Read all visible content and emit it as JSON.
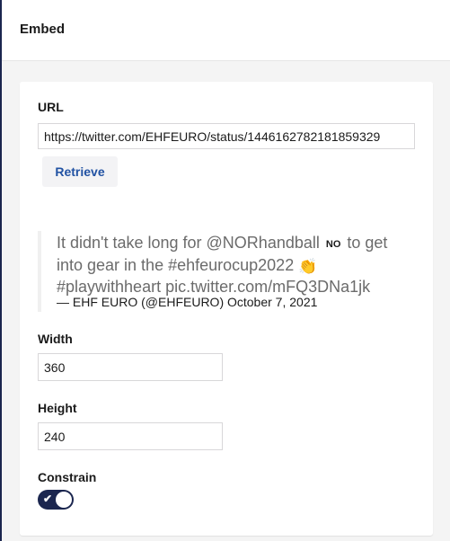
{
  "header": {
    "title": "Embed"
  },
  "form": {
    "url": {
      "label": "URL",
      "value": "https://twitter.com/EHFEURO/status/1446162782181859329"
    },
    "retrieve_label": "Retrieve",
    "preview": {
      "text_before_flag": "It didn't take long for @NORhandball ",
      "flag": "NO",
      "text_after_flag": " to get into gear in the #ehfeurocup2022 ",
      "emoji": "👏",
      "text_end": " #playwithheart pic.twitter.com/mFQ3DNa1jk",
      "citation": "— EHF EURO (@EHFEURO) October 7, 2021"
    },
    "width": {
      "label": "Width",
      "value": "360"
    },
    "height": {
      "label": "Height",
      "value": "240"
    },
    "constrain": {
      "label": "Constrain",
      "enabled": true,
      "check_glyph": "✔"
    }
  },
  "colors": {
    "primary": "#1b264f",
    "link": "#2152a3",
    "quote_text": "#6b6b6b",
    "quote_border": "#f0f0f0"
  }
}
